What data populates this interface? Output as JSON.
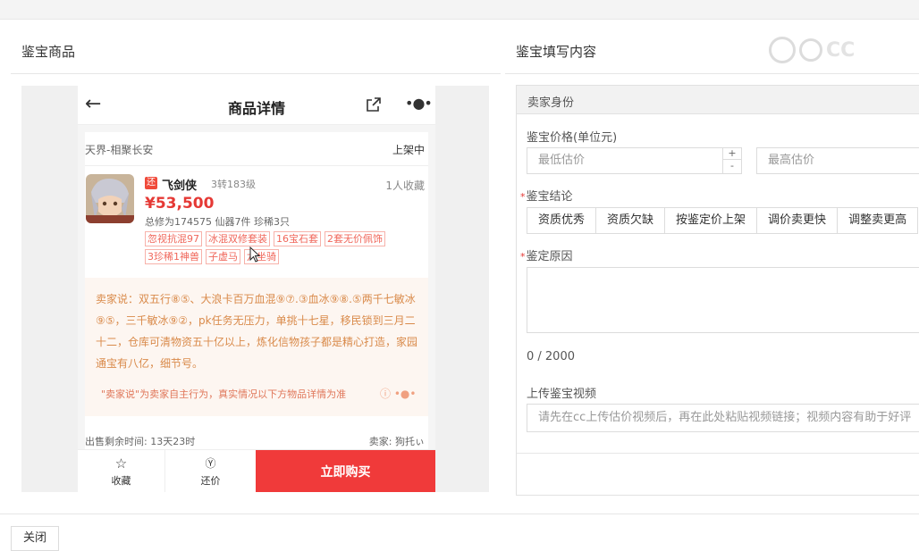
{
  "left_section": {
    "title": "鉴宝商品"
  },
  "right_section": {
    "title": "鉴宝填写内容"
  },
  "watermark": {
    "text": "CC"
  },
  "phone": {
    "header_title": "商品详情",
    "server": "天界-相聚长安",
    "status": "上架中",
    "badge": "还",
    "char_name": "飞剑侠",
    "char_level": "3转183级",
    "favorites": "1人收藏",
    "price": "¥53,500",
    "stats": "总修为174575  仙器7件  珍稀3只",
    "tags": [
      "忽视抗混97",
      "冰混双修套装",
      "16宝石套",
      "2套无价佩饰",
      "3珍稀1神兽",
      "子虚马",
      "六坐骑"
    ],
    "seller_say": "卖家说：双五行⑧⑤、大浪卡百万血混⑨⑦.③血冰⑨⑧.⑤两千七敏冰⑨⑤，三千敏冰⑨②，pk任务无压力，单挑十七星，移民锁到三月二十二，仓库可清物资五十亿以上，炼化信物孩子都是精心打造，家园通宝有八亿，细节号。",
    "seller_note": "\"卖家说\"为卖家自主行为，真实情况以下方物品详情为准",
    "remaining_time": "出售剩余时间: 13天23时",
    "seller": "卖家: 狗托ぃ",
    "fav_label": "收藏",
    "bargain_label": "还价",
    "buy_label": "立即购买"
  },
  "form": {
    "header": "卖家身份",
    "price_label": "鉴宝价格(单位元)",
    "min_price_placeholder": "最低估价",
    "max_price_placeholder": "最高估价",
    "conclusion_label": "鉴宝结论",
    "conclusion_options": [
      "资质优秀",
      "资质欠缺",
      "按鉴定价上架",
      "调价卖更快",
      "调整卖更高"
    ],
    "reason_label": "鉴定原因",
    "counter": "0 / 2000",
    "video_label": "上传鉴宝视频",
    "video_placeholder": "请先在cc上传估价视频后，再在此处粘贴视频链接；视频内容有助于好评"
  },
  "footer": {
    "close_label": "关闭"
  },
  "colors": {
    "accent_red": "#f03a3a",
    "price_red": "#e53935",
    "tag_red": "#f0665a",
    "seller_orange": "#d98a4a"
  }
}
